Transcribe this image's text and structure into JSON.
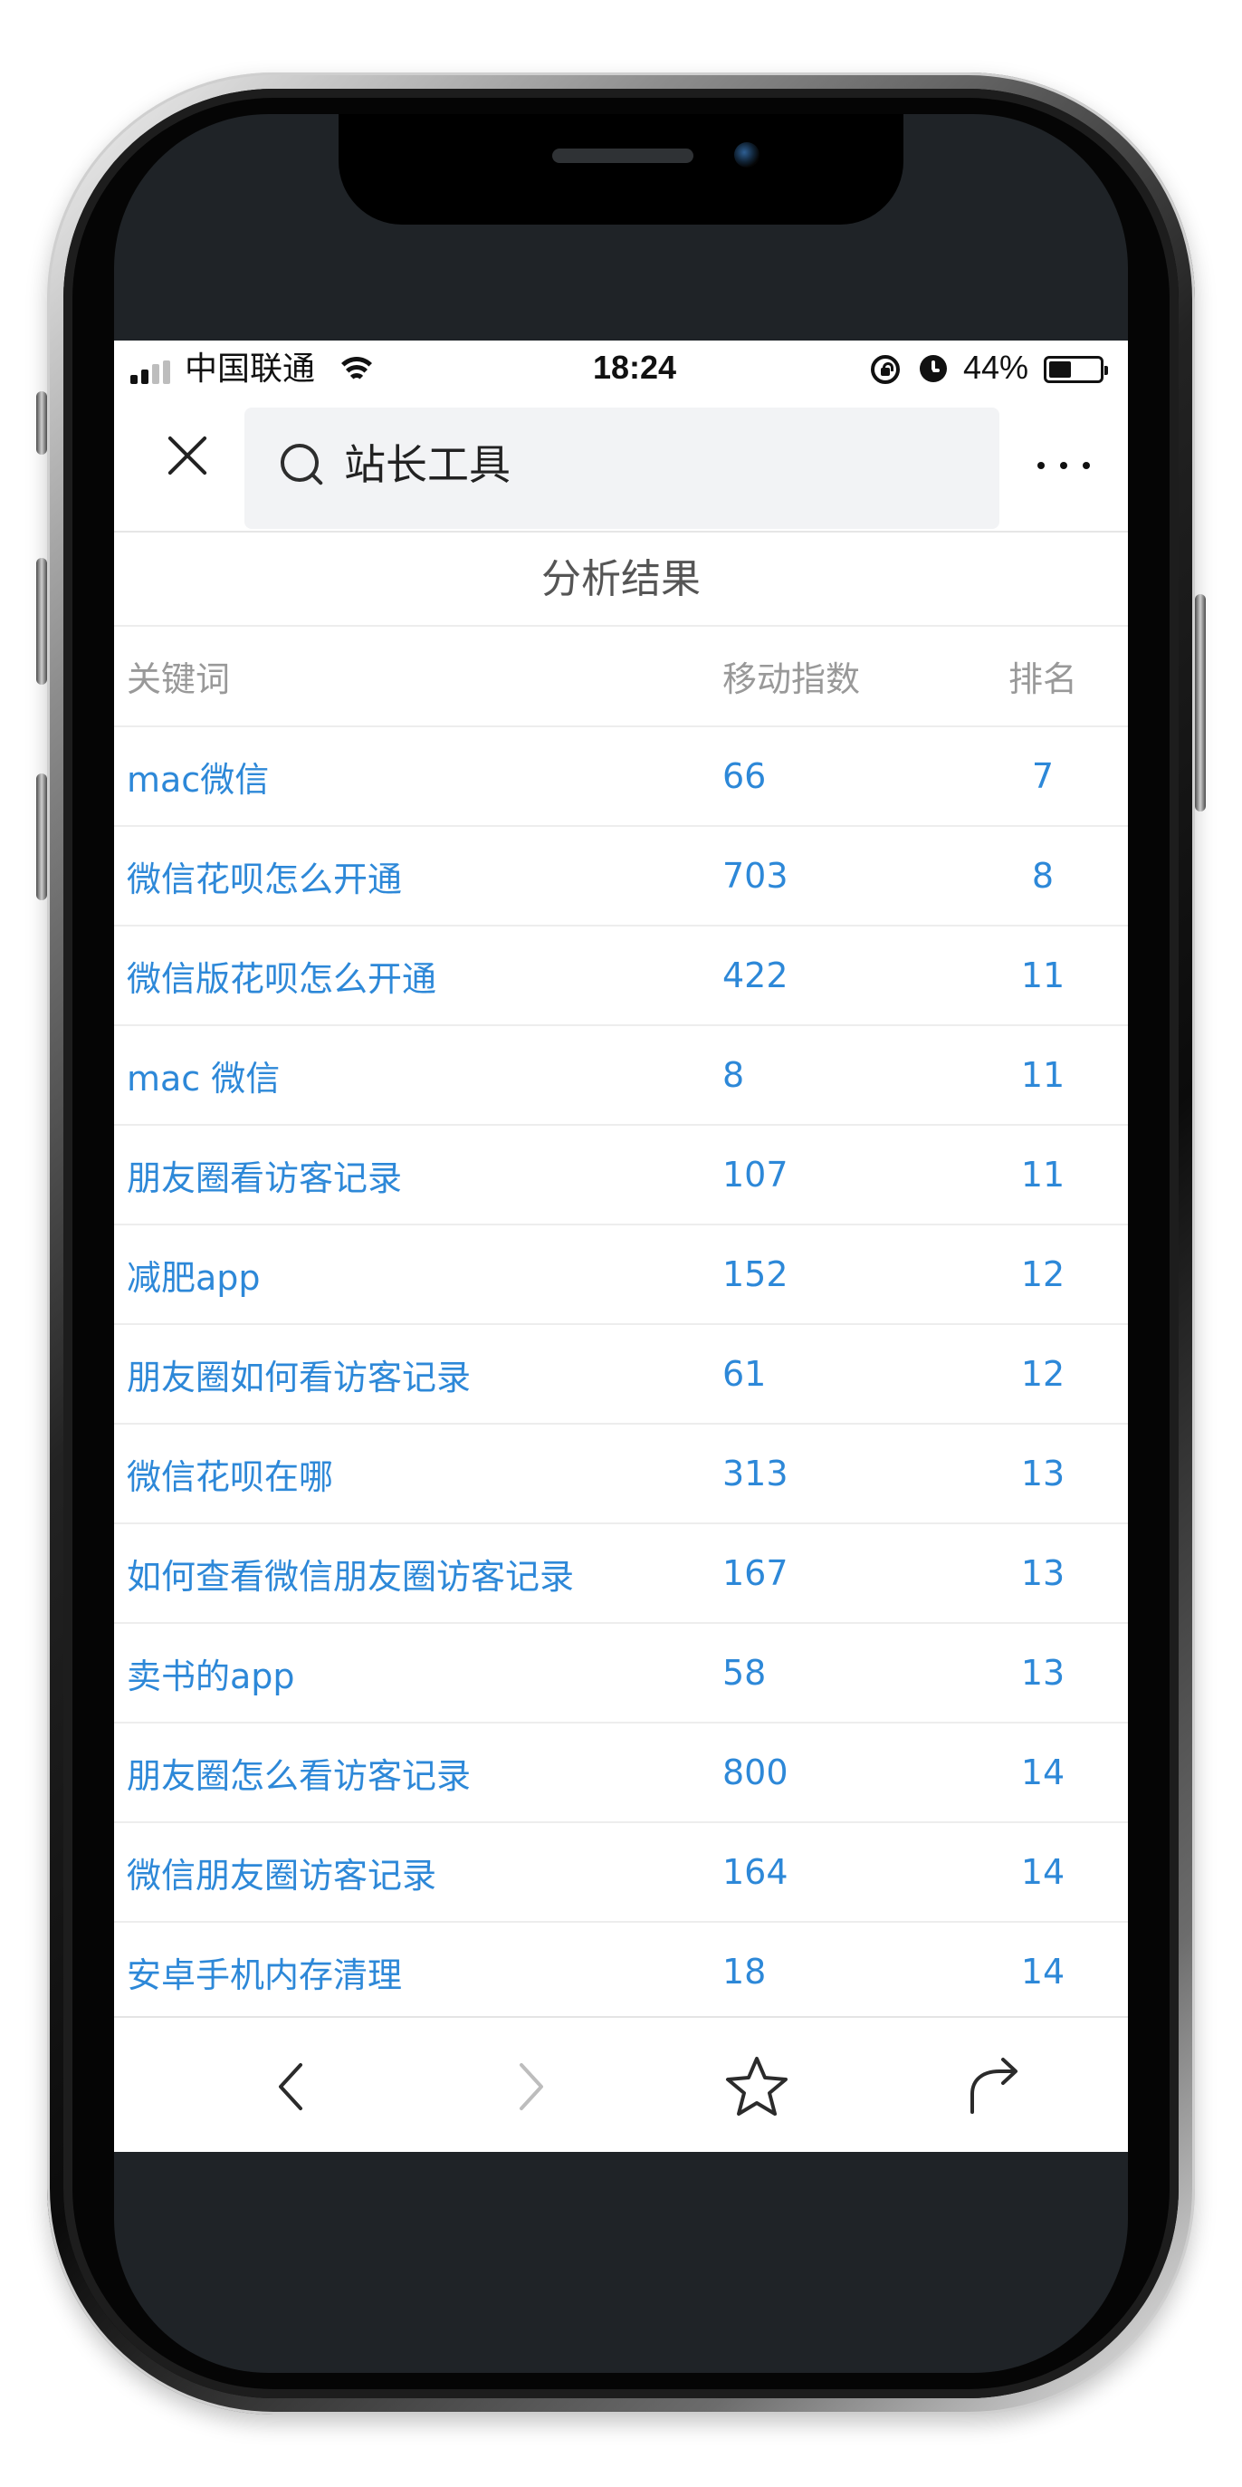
{
  "status_bar": {
    "carrier": "中国联通",
    "time": "18:24",
    "battery": "44%",
    "battery_level": 0.44
  },
  "nav": {
    "search_query": "站长工具"
  },
  "page": {
    "title": "分析结果"
  },
  "table": {
    "headers": {
      "keyword": "关键词",
      "mobile_index": "移动指数",
      "rank": "排名"
    },
    "rows": [
      {
        "keyword": "mac微信",
        "mobile_index": "66",
        "rank": "7"
      },
      {
        "keyword": "微信花呗怎么开通",
        "mobile_index": "703",
        "rank": "8"
      },
      {
        "keyword": "微信版花呗怎么开通",
        "mobile_index": "422",
        "rank": "11"
      },
      {
        "keyword": "mac 微信",
        "mobile_index": "8",
        "rank": "11"
      },
      {
        "keyword": "朋友圈看访客记录",
        "mobile_index": "107",
        "rank": "11"
      },
      {
        "keyword": "减肥app",
        "mobile_index": "152",
        "rank": "12"
      },
      {
        "keyword": "朋友圈如何看访客记录",
        "mobile_index": "61",
        "rank": "12"
      },
      {
        "keyword": "微信花呗在哪",
        "mobile_index": "313",
        "rank": "13"
      },
      {
        "keyword": "如何查看微信朋友圈访客记录",
        "mobile_index": "167",
        "rank": "13"
      },
      {
        "keyword": "卖书的app",
        "mobile_index": "58",
        "rank": "13"
      },
      {
        "keyword": "朋友圈怎么看访客记录",
        "mobile_index": "800",
        "rank": "14"
      },
      {
        "keyword": "微信朋友圈访客记录",
        "mobile_index": "164",
        "rank": "14"
      },
      {
        "keyword": "安卓手机内存清理",
        "mobile_index": "18",
        "rank": "14"
      }
    ]
  },
  "icons": {
    "signal": "signal-bars-icon",
    "wifi": "wifi-icon",
    "rotation_lock": "rotation-lock-icon",
    "alarm": "alarm-icon",
    "battery": "battery-icon",
    "close": "close-icon",
    "search": "search-icon",
    "more": "more-icon",
    "back": "chevron-left-icon",
    "forward": "chevron-right-icon",
    "favorite": "star-icon",
    "share": "share-icon"
  },
  "colors": {
    "link_blue": "#2d88d8",
    "header_gray": "#999999",
    "divider": "#ededed",
    "search_background": "#f2f3f5"
  }
}
